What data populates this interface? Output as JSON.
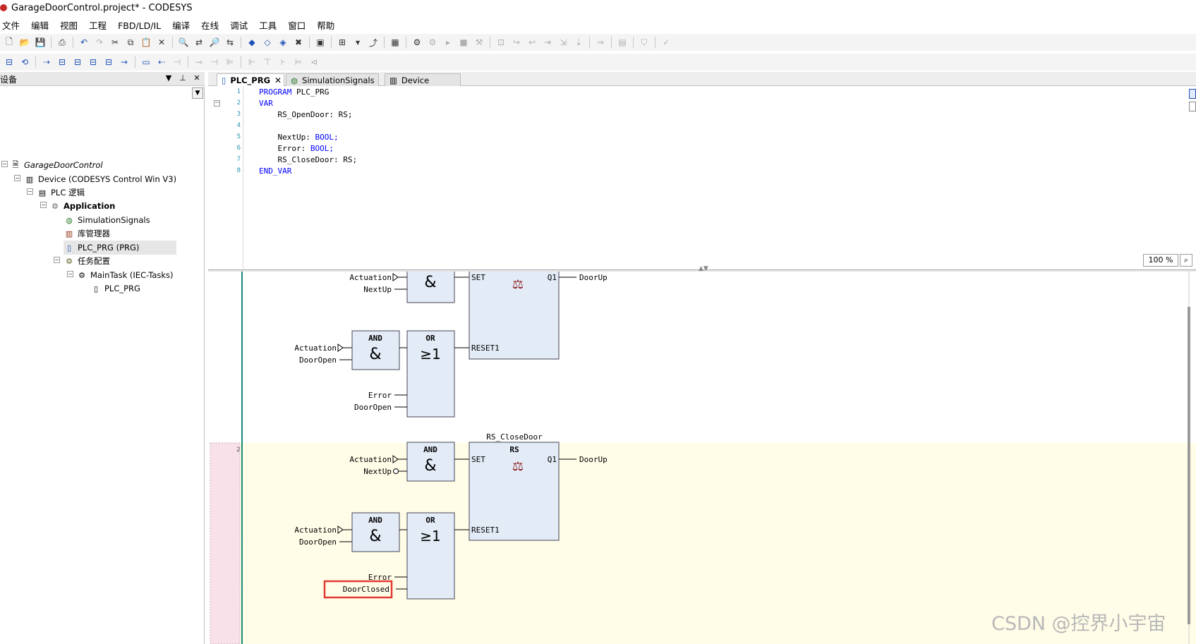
{
  "window": {
    "title": "GarageDoorControl.project* - CODESYS"
  },
  "menu": [
    "文件",
    "编辑",
    "视图",
    "工程",
    "FBD/LD/IL",
    "编译",
    "在线",
    "调试",
    "工具",
    "窗口",
    "帮助"
  ],
  "device_panel": {
    "title": "设备",
    "tree": [
      {
        "label": "GarageDoorControl",
        "icon": "project-icon",
        "italic": true
      },
      {
        "label": "Device (CODESYS Control Win V3)",
        "icon": "device-icon"
      },
      {
        "label": "PLC 逻辑",
        "icon": "plc-logic-icon"
      },
      {
        "label": "Application",
        "icon": "application-gear-icon",
        "bold": true
      },
      {
        "label": "SimulationSignals",
        "icon": "globe-icon"
      },
      {
        "label": "库管理器",
        "icon": "library-icon"
      },
      {
        "label": "PLC_PRG (PRG)",
        "icon": "pou-icon"
      },
      {
        "label": "任务配置",
        "icon": "task-config-icon"
      },
      {
        "label": "MainTask (IEC-Tasks)",
        "icon": "task-icon"
      },
      {
        "label": "PLC_PRG",
        "icon": "pou-call-icon"
      }
    ]
  },
  "tabs": [
    {
      "label": "PLC_PRG",
      "active": true
    },
    {
      "label": "SimulationSignals"
    },
    {
      "label": "Device"
    }
  ],
  "declaration": {
    "line_numbers": [
      "1",
      "2",
      "3",
      "4",
      "5",
      "6",
      "7",
      "8"
    ],
    "lines": [
      {
        "kw": "PROGRAM",
        "rest": " PLC_PRG"
      },
      {
        "kw": "VAR",
        "rest": ""
      },
      {
        "kw": "",
        "rest": "    RS_OpenDoor: RS;"
      },
      {
        "kw": "",
        "rest": ""
      },
      {
        "kw": "",
        "rest": "    NextUp: ",
        "type": "BOOL;"
      },
      {
        "kw": "",
        "rest": "    Error: ",
        "type": "BOOL;"
      },
      {
        "kw": "",
        "rest": "    RS_CloseDoor: RS;"
      },
      {
        "kw": "END_VAR",
        "rest": ""
      }
    ]
  },
  "zoom": "100 %",
  "fbd": {
    "network1": {
      "and1": {
        "symbol": "&",
        "in1": "Actuation",
        "in2": "NextUp"
      },
      "and2": {
        "title": "AND",
        "symbol": "&",
        "in1": "Actuation",
        "in2": "DoorOpen"
      },
      "or": {
        "title": "OR",
        "symbol": "≥1",
        "in3": "Error",
        "in4": "DoorOpen"
      },
      "rs": {
        "set": "SET",
        "reset": "RESET1",
        "q": "Q1",
        "out": "DoorUp"
      }
    },
    "network2": {
      "number": "2",
      "instance": "RS_CloseDoor",
      "and1": {
        "title": "AND",
        "symbol": "&",
        "in1": "Actuation",
        "in2": "NextUp"
      },
      "and2": {
        "title": "AND",
        "symbol": "&",
        "in1": "Actuation",
        "in2": "DoorOpen"
      },
      "or": {
        "title": "OR",
        "symbol": "≥1",
        "in3": "Error",
        "in4": "DoorClosed"
      },
      "rs": {
        "title": "RS",
        "set": "SET",
        "reset": "RESET1",
        "q": "Q1",
        "out": "DoorUp"
      },
      "highlight_color": "#e53935"
    }
  },
  "watermark": "CSDN @控界小宇宙"
}
